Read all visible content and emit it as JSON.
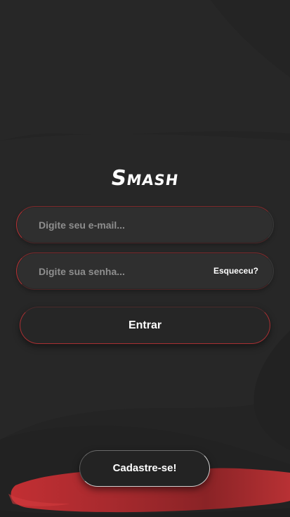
{
  "app": {
    "logo_text": "Smash"
  },
  "login": {
    "email_placeholder": "Digite seu e-mail...",
    "email_value": "",
    "password_placeholder": "Digite sua senha...",
    "password_value": "",
    "forgot_label": "Esqueceu?",
    "submit_label": "Entrar"
  },
  "footer": {
    "signup_label": "Cadastre-se!"
  },
  "colors": {
    "background": "#252525",
    "accent_red": "#b83134",
    "text_white": "#ffffff",
    "placeholder_gray": "#8e8e8e"
  }
}
